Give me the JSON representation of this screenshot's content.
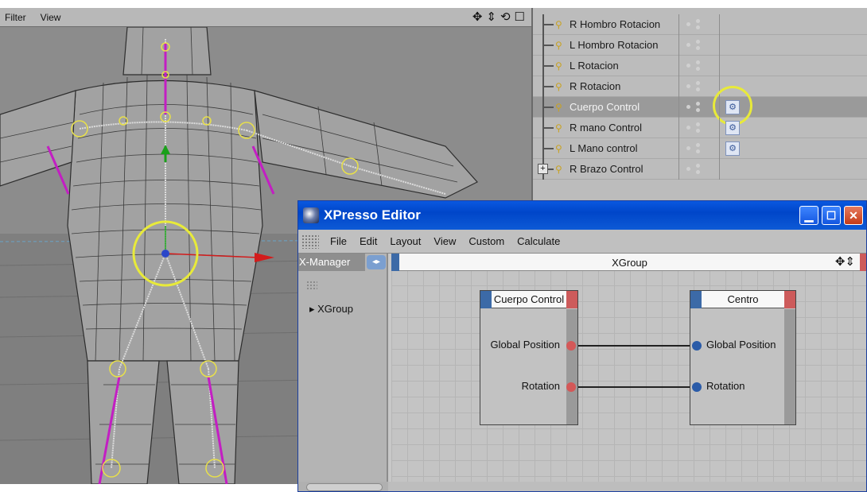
{
  "viewport": {
    "menu": [
      "Filter",
      "View"
    ],
    "nav_icons": [
      "move-icon",
      "scale-icon",
      "rotate-icon",
      "maximize-icon"
    ]
  },
  "object_manager": {
    "items": [
      {
        "label": "R Hombro Rotacion",
        "selected": false,
        "has_tag": false,
        "expandable": false
      },
      {
        "label": "L Hombro Rotacion",
        "selected": false,
        "has_tag": false,
        "expandable": false
      },
      {
        "label": "L Rotacion",
        "selected": false,
        "has_tag": false,
        "expandable": false
      },
      {
        "label": "R Rotacion",
        "selected": false,
        "has_tag": false,
        "expandable": false
      },
      {
        "label": "Cuerpo Control",
        "selected": true,
        "has_tag": true,
        "expandable": false
      },
      {
        "label": "R mano Control",
        "selected": false,
        "has_tag": true,
        "expandable": false
      },
      {
        "label": "L Mano control",
        "selected": false,
        "has_tag": true,
        "expandable": false
      },
      {
        "label": "R Brazo Control",
        "selected": false,
        "has_tag": false,
        "expandable": true
      }
    ]
  },
  "xpresso": {
    "title": "XPresso Editor",
    "menu": [
      "File",
      "Edit",
      "Layout",
      "View",
      "Custom",
      "Calculate"
    ],
    "manager_tab": "X-Manager",
    "manager_item": "XGroup",
    "group_title": "XGroup",
    "nodes": {
      "source": {
        "title": "Cuerpo Control",
        "ports": [
          "Global Position",
          "Rotation"
        ]
      },
      "target": {
        "title": "Centro",
        "ports": [
          "Global Position",
          "Rotation"
        ]
      }
    }
  },
  "colors": {
    "highlight_ring": "#e8ea3a",
    "xp_titlebar": "#0a58e0",
    "port_out": "#d45858",
    "port_in": "#2a5ba8",
    "bone": "#c31ec3"
  }
}
